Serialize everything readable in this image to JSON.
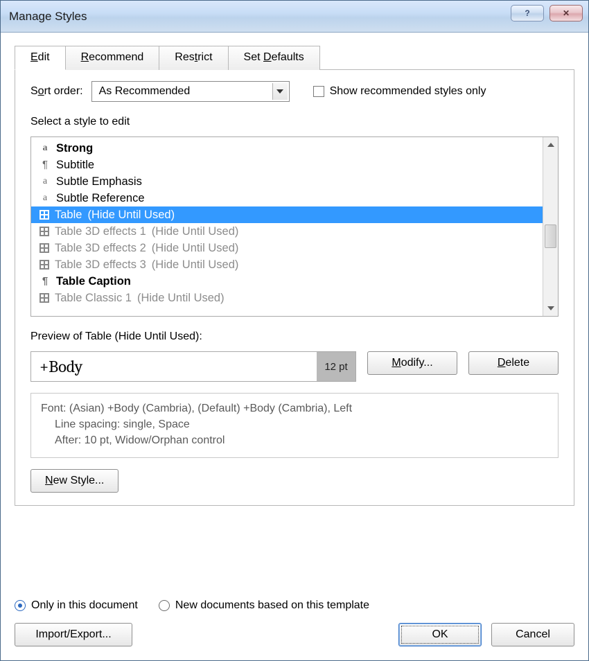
{
  "title": "Manage Styles",
  "tabs": {
    "edit": "Edit",
    "recommend": "Recommend",
    "restrict": "Restrict",
    "defaults": "Set Defaults"
  },
  "sort": {
    "label": "Sort order:",
    "value": "As Recommended",
    "showRecOnly": "Show recommended styles only"
  },
  "selectLabel": "Select a style to edit",
  "styles": [
    {
      "icon": "a",
      "name": "Strong",
      "note": "",
      "bold": true,
      "muted": false,
      "selected": false
    },
    {
      "icon": "para",
      "name": "Subtitle",
      "note": "",
      "bold": false,
      "muted": false,
      "selected": false
    },
    {
      "icon": "a",
      "name": "Subtle Emphasis",
      "note": "",
      "bold": false,
      "muted": false,
      "selected": false
    },
    {
      "icon": "a",
      "name": "Subtle Reference",
      "note": "",
      "bold": false,
      "muted": false,
      "selected": false
    },
    {
      "icon": "grid",
      "name": "Table",
      "note": "(Hide Until Used)",
      "bold": false,
      "muted": false,
      "selected": true
    },
    {
      "icon": "grid",
      "name": "Table 3D effects 1",
      "note": "(Hide Until Used)",
      "bold": false,
      "muted": true,
      "selected": false
    },
    {
      "icon": "grid",
      "name": "Table 3D effects 2",
      "note": "(Hide Until Used)",
      "bold": false,
      "muted": true,
      "selected": false
    },
    {
      "icon": "grid",
      "name": "Table 3D effects 3",
      "note": "(Hide Until Used)",
      "bold": false,
      "muted": true,
      "selected": false
    },
    {
      "icon": "para",
      "name": "Table Caption",
      "note": "",
      "bold": true,
      "muted": false,
      "selected": false
    },
    {
      "icon": "grid",
      "name": "Table Classic 1",
      "note": "(Hide Until Used)",
      "bold": false,
      "muted": true,
      "selected": false
    }
  ],
  "previewLabel": "Preview of Table  (Hide Until Used):",
  "preview": {
    "font": "+Body",
    "pt": "12 pt"
  },
  "buttons": {
    "modify": "Modify...",
    "delete": "Delete",
    "newStyle": "New Style...",
    "importExport": "Import/Export...",
    "ok": "OK",
    "cancel": "Cancel"
  },
  "desc": {
    "l1": "Font: (Asian) +Body (Cambria), (Default) +Body (Cambria), Left",
    "l2": "Line spacing:  single, Space",
    "l3": "After:  10 pt, Widow/Orphan control"
  },
  "radios": {
    "doc": "Only in this document",
    "tpl": "New documents based on this template"
  }
}
